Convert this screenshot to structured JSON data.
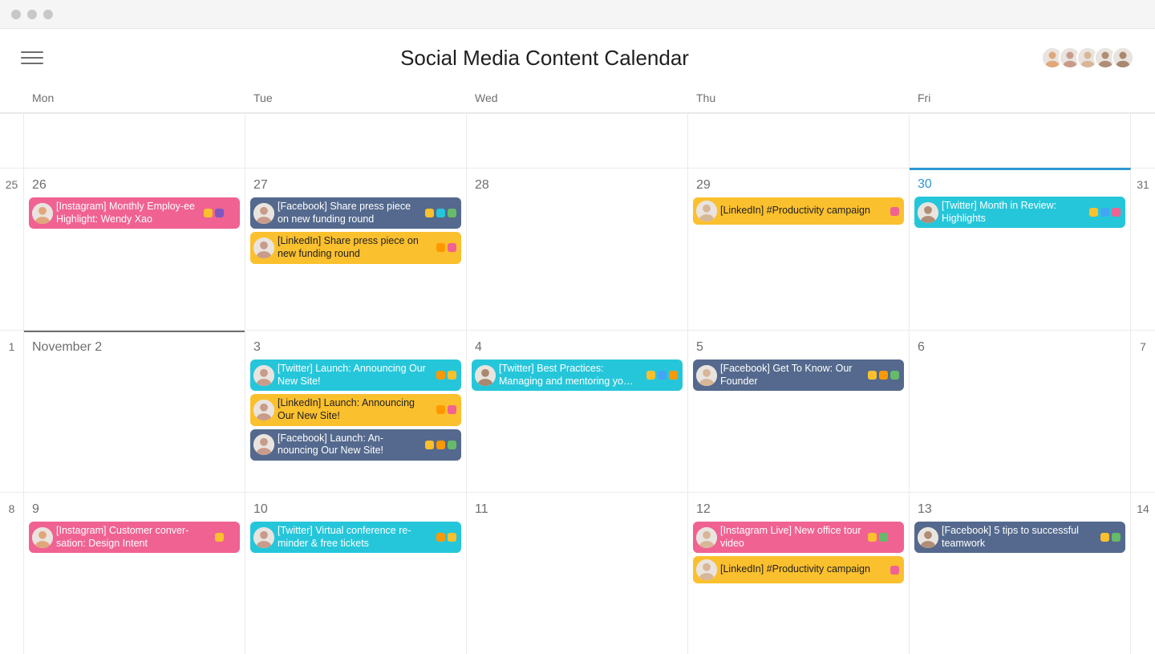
{
  "header": {
    "title": "Social Media Content Calendar",
    "avatars": [
      "p1",
      "p2",
      "p3",
      "p4",
      "p5"
    ]
  },
  "dayNames": [
    "Mon",
    "Tue",
    "Wed",
    "Thu",
    "Fri"
  ],
  "rows": [
    {
      "type": "partial",
      "gutterLeft": "",
      "gutterRight": "",
      "cells": [
        {
          "label": ""
        },
        {
          "label": ""
        },
        {
          "label": ""
        },
        {
          "label": ""
        },
        {
          "label": ""
        }
      ]
    },
    {
      "type": "full",
      "gutterLeft": "25",
      "gutterRight": "31",
      "cells": [
        {
          "label": "26",
          "selected": true,
          "tasks": [
            {
              "color": "pink",
              "light": false,
              "assignee": "p1",
              "title": "[Instagram] Monthly Employ-ee Highlight: Wendy Xao",
              "tags": [
                "yellow",
                "purple",
                "pink"
              ]
            }
          ]
        },
        {
          "label": "27",
          "tasks": [
            {
              "color": "slate",
              "assignee": "p2",
              "title": "[Facebook] Share press piece on new funding round",
              "tags": [
                "yellow",
                "teal",
                "green"
              ]
            },
            {
              "color": "yellow",
              "light": true,
              "assignee": "p2",
              "title": "[LinkedIn] Share press piece on new funding round",
              "tags": [
                "orange",
                "pink"
              ]
            }
          ]
        },
        {
          "label": "28"
        },
        {
          "label": "29",
          "tasks": [
            {
              "color": "yellow",
              "light": true,
              "assignee": "p3",
              "title": "[LinkedIn] #Productivity campaign",
              "tags": [
                "pink"
              ]
            }
          ]
        },
        {
          "label": "30",
          "today": true,
          "tasks": [
            {
              "color": "teal",
              "light": false,
              "assignee": "p4",
              "title": "[Twitter] Month in Review: Highlights",
              "tags": [
                "yellow",
                "blue",
                "pink"
              ]
            }
          ]
        }
      ]
    },
    {
      "type": "full",
      "gutterLeft": "1",
      "gutterRight": "7",
      "cells": [
        {
          "label": "November 2"
        },
        {
          "label": "3",
          "tasks": [
            {
              "color": "teal",
              "assignee": "p2",
              "title": "[Twitter] Launch: Announcing Our New Site!",
              "tags": [
                "orange",
                "yellow"
              ]
            },
            {
              "color": "yellow",
              "light": true,
              "assignee": "p2",
              "title": "[LinkedIn] Launch: Announcing Our New Site!",
              "tags": [
                "orange",
                "pink"
              ]
            },
            {
              "color": "slate",
              "assignee": "p2",
              "title": "[Facebook] Launch: An-nouncing Our New Site!",
              "tags": [
                "yellow",
                "orange",
                "green"
              ]
            }
          ]
        },
        {
          "label": "4",
          "tasks": [
            {
              "color": "teal",
              "assignee": "p5",
              "title": "[Twitter] Best Practices: Managing and mentoring yo…",
              "tags": [
                "yellow",
                "blue",
                "orange"
              ]
            }
          ]
        },
        {
          "label": "5",
          "tasks": [
            {
              "color": "slate",
              "assignee": "p3",
              "title": "[Facebook] Get To Know: Our Founder",
              "tags": [
                "yellow",
                "orange",
                "green"
              ]
            }
          ]
        },
        {
          "label": "6"
        }
      ]
    },
    {
      "type": "full",
      "gutterLeft": "8",
      "gutterRight": "14",
      "cells": [
        {
          "label": "9",
          "tasks": [
            {
              "color": "pink",
              "assignee": "p1",
              "title": "[Instagram] Customer conver-sation: Design Intent",
              "tags": [
                "yellow",
                "pink"
              ]
            }
          ]
        },
        {
          "label": "10",
          "tasks": [
            {
              "color": "teal",
              "assignee": "p2",
              "title": "[Twitter] Virtual conference re-minder & free tickets",
              "tags": [
                "orange",
                "yellow"
              ]
            }
          ]
        },
        {
          "label": "11"
        },
        {
          "label": "12",
          "tasks": [
            {
              "color": "pink",
              "assignee": "p3",
              "title": "[Instagram Live] New office tour video",
              "tags": [
                "yellow",
                "green",
                "pink"
              ]
            },
            {
              "color": "yellow",
              "light": true,
              "assignee": "p3",
              "title": "[LinkedIn] #Productivity campaign",
              "tags": [
                "pink"
              ]
            }
          ]
        },
        {
          "label": "13",
          "tasks": [
            {
              "color": "slate",
              "assignee": "p4",
              "title": "[Facebook] 5 tips to successful teamwork",
              "tags": [
                "yellow",
                "green"
              ]
            }
          ]
        }
      ]
    }
  ],
  "avatarColors": {
    "p1": "#e0a87a",
    "p2": "#c99b8a",
    "p3": "#d8b698",
    "p4": "#b08d76",
    "p5": "#a9886f"
  }
}
